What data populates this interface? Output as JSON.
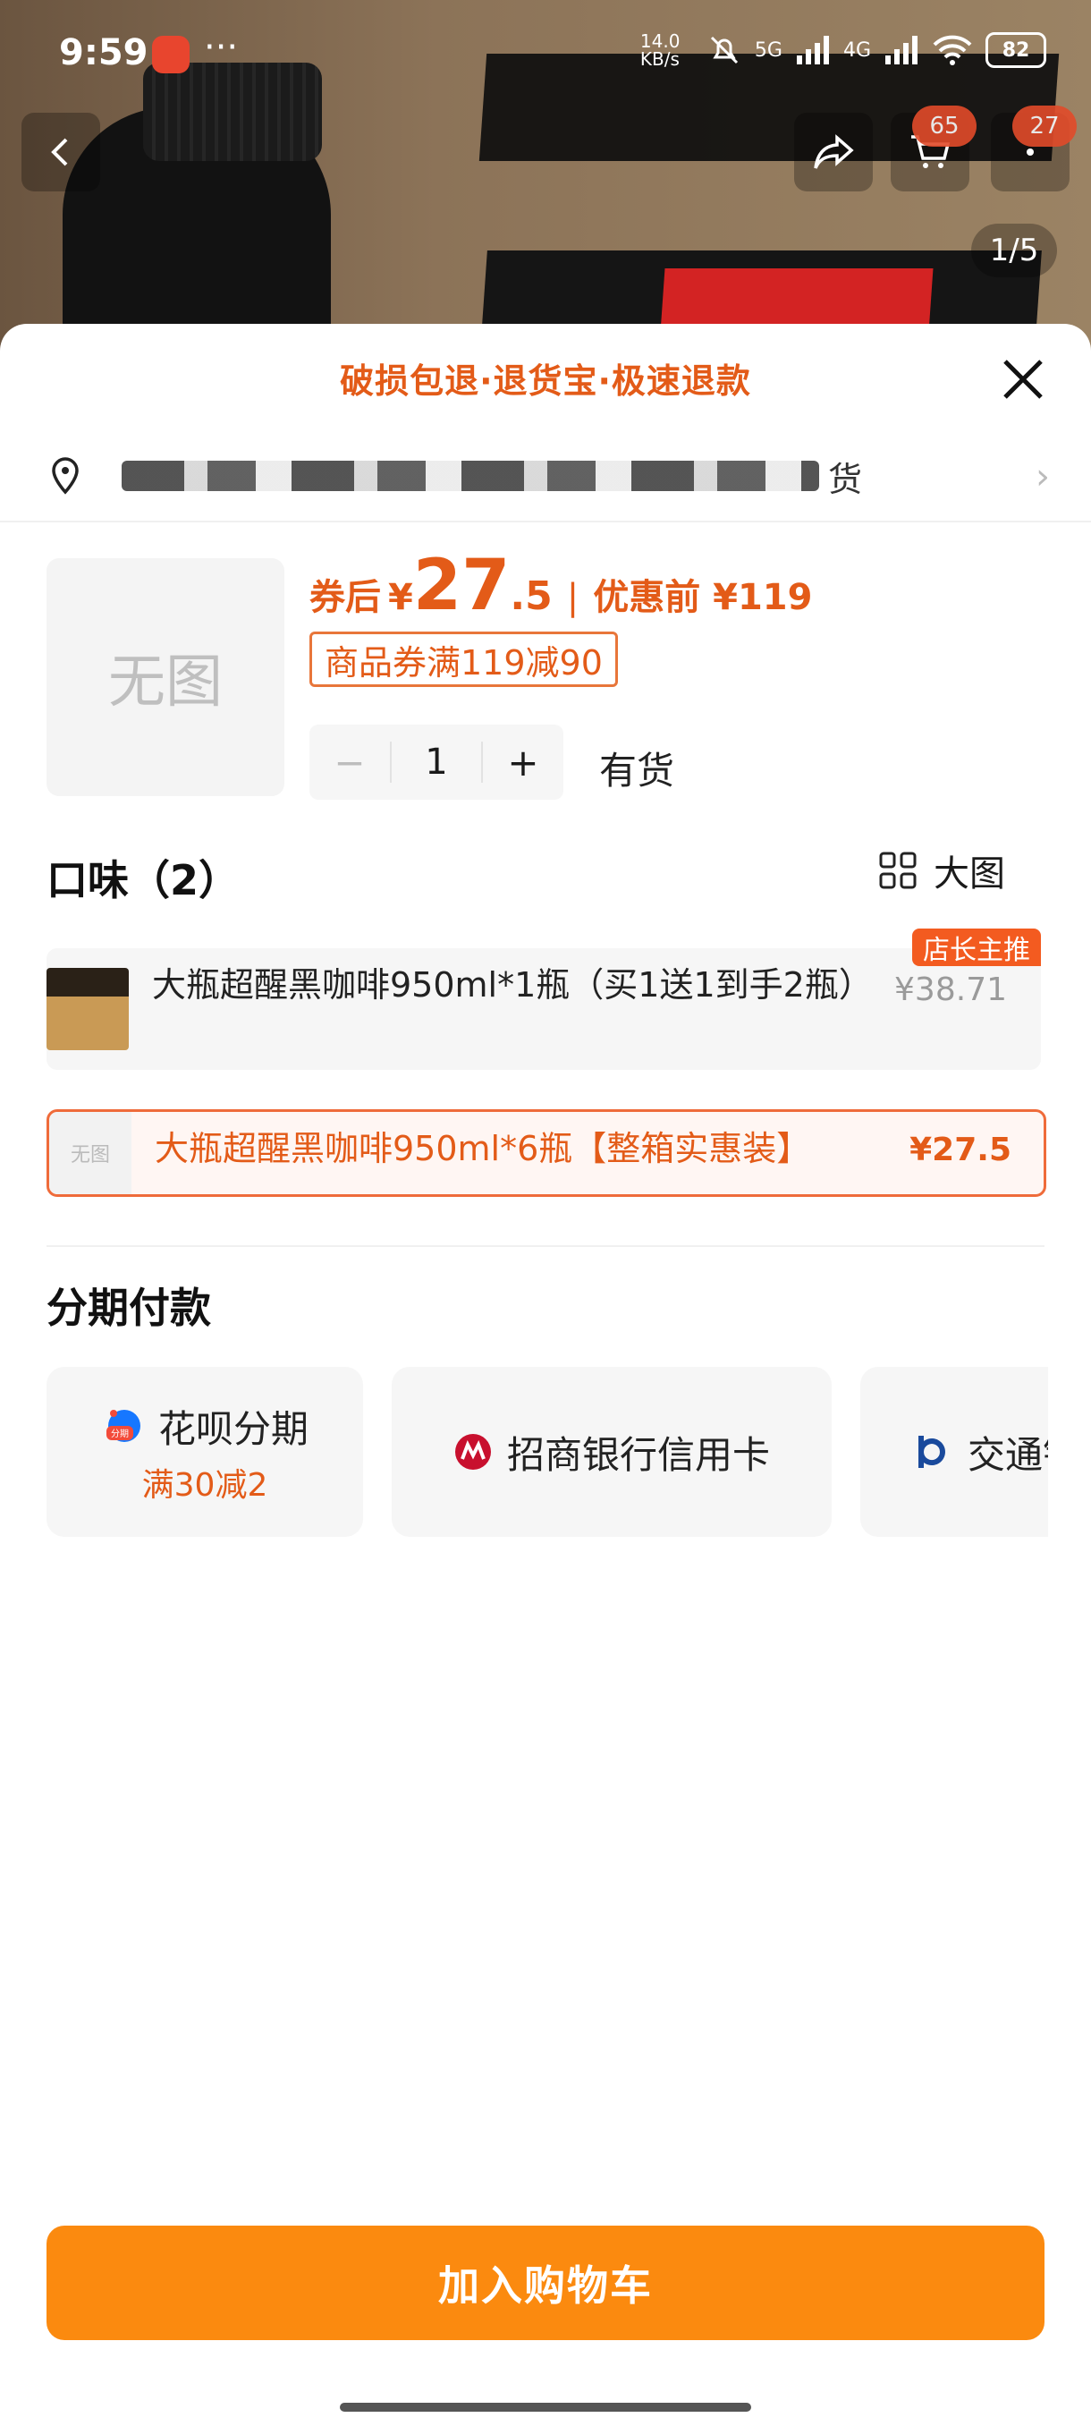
{
  "status_bar": {
    "time": "9:59",
    "net_speed": "14.0 KB/s",
    "signal_5g": "5G",
    "signal_4g": "4G",
    "battery": "82"
  },
  "header": {
    "cart_badge": "65",
    "more_badge": "27",
    "image_index": "1/5"
  },
  "sheet": {
    "banner": "破损包退·退货宝·极速退款",
    "address_suffix": "货",
    "thumb_placeholder": "无图",
    "price": {
      "after_label": "券后",
      "currency": "¥",
      "integer": "27",
      "decimal": ".5",
      "separator": "|",
      "before_label": "优惠前 ¥119"
    },
    "coupon": "商品券满119减90",
    "quantity": "1",
    "stock_status": "有货",
    "flavor_title": "口味（2）",
    "big_view_label": "大图",
    "variants": [
      {
        "name": "大瓶超醒黑咖啡950ml*1瓶（买1送1到手2瓶）",
        "price": "¥38.71",
        "tag": "店长主推"
      },
      {
        "name": "大瓶超醒黑咖啡950ml*6瓶【整箱实惠装】",
        "price": "¥27.5",
        "thumb": "无图"
      }
    ],
    "installment_title": "分期付款",
    "installments": [
      {
        "name": "花呗分期",
        "sub": "满30减2",
        "icon": "huabei-icon",
        "icon_label": "分期"
      },
      {
        "name": "招商银行信用卡",
        "icon": "cmb-icon"
      },
      {
        "name": "交通银行信用卡",
        "icon": "bocom-icon"
      }
    ],
    "add_to_cart": "加入购物车"
  },
  "colors": {
    "accent": "#e35b18",
    "cta": "#fb8a0f",
    "tag": "#f35b20"
  }
}
